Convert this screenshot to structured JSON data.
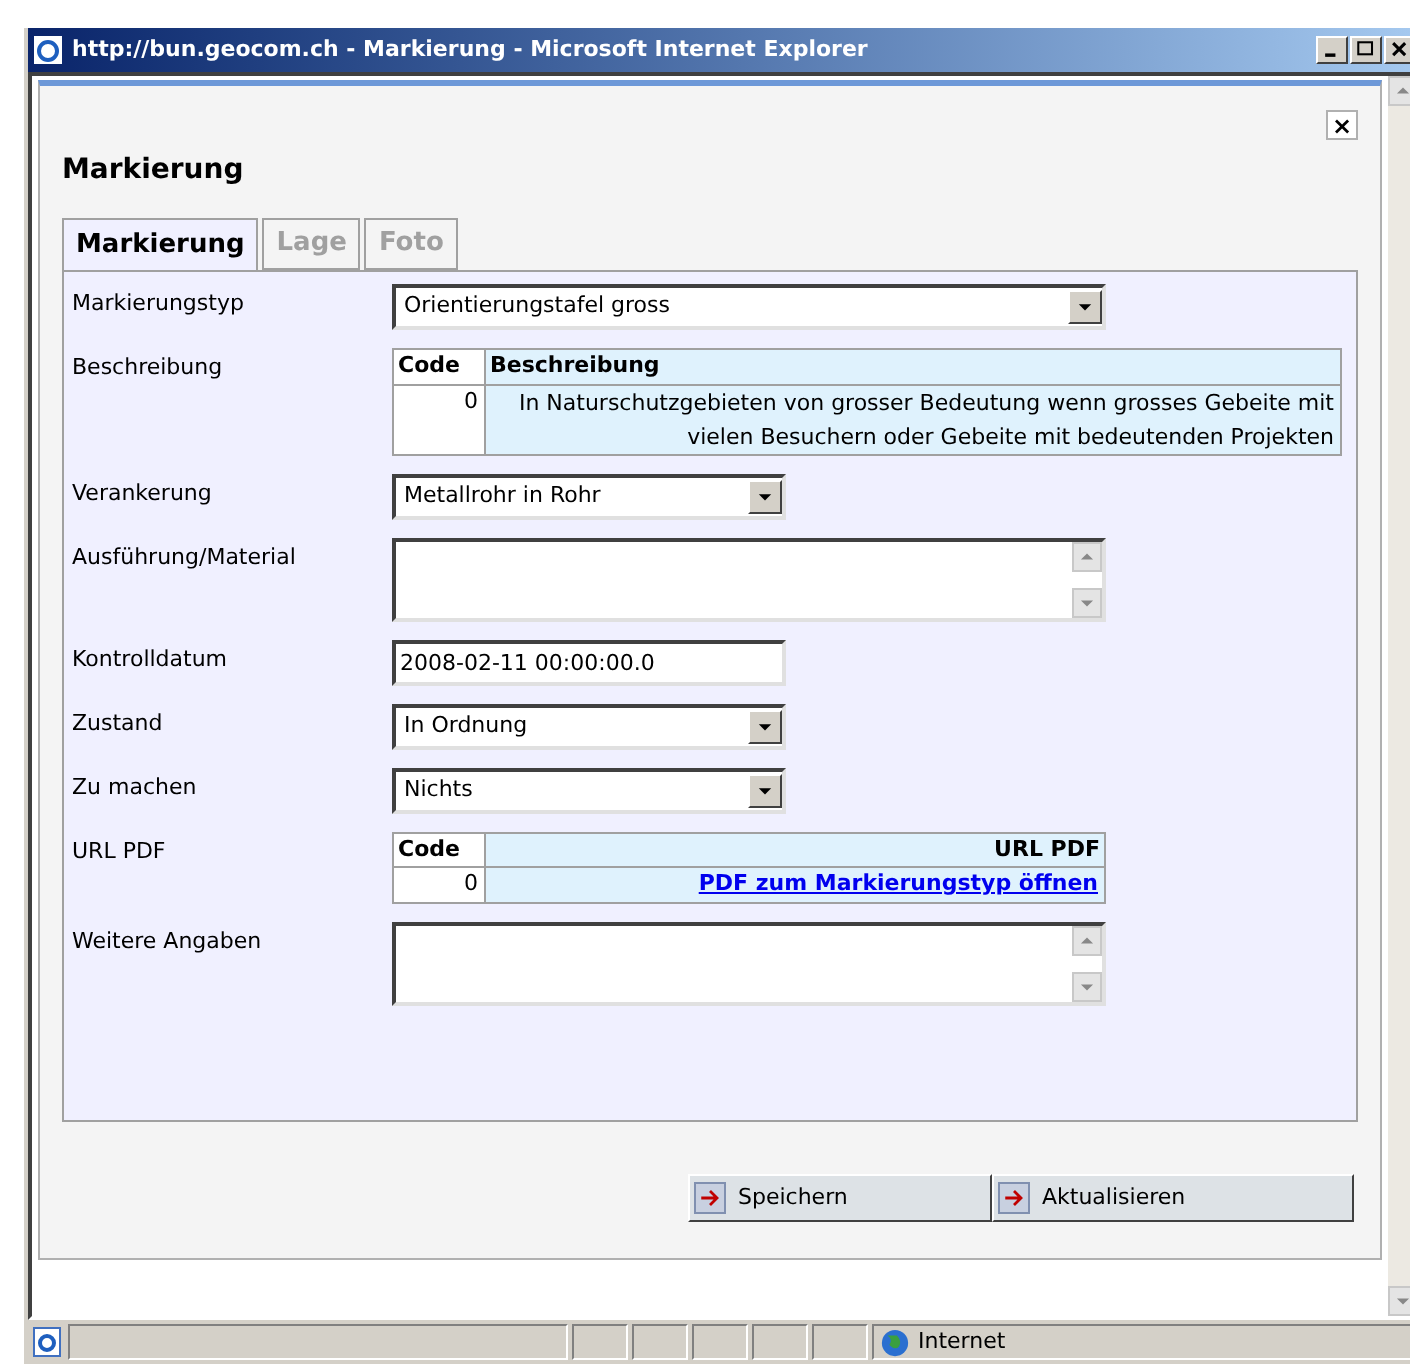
{
  "window": {
    "title": "http://bun.geocom.ch - Markierung - Microsoft Internet Explorer"
  },
  "dialog": {
    "close": "×",
    "title": "Markierung"
  },
  "tabs": [
    {
      "label": "Markierung",
      "selected": true
    },
    {
      "label": "Lage",
      "selected": false
    },
    {
      "label": "Foto",
      "selected": false
    }
  ],
  "fields": [
    {
      "kind": "select",
      "label": "Markierungstyp",
      "value": "Orientierungstafel gross"
    },
    {
      "kind": "table",
      "label": "Beschreibung",
      "columns": [
        "Code",
        "Beschreibung"
      ],
      "rows": [
        {
          "code": "0",
          "text": "In Naturschutzgebieten von grosser Bedeutung wenn grosses Gebeite mit vielen Besuchern oder Gebeite mit bedeutenden Projekten",
          "link": false
        }
      ]
    },
    {
      "kind": "select",
      "label": "Verankerung",
      "value": "Metallrohr in Rohr"
    },
    {
      "kind": "textarea",
      "label": "Ausführung/Material"
    },
    {
      "kind": "text",
      "label": "Kontrolldatum",
      "value": "2008-02-11 00:00:00.0"
    },
    {
      "kind": "select",
      "label": "Zustand",
      "value": "In Ordnung"
    },
    {
      "kind": "select",
      "label": "Zu machen",
      "value": "Nichts"
    },
    {
      "kind": "table",
      "label": "URL PDF",
      "columns": [
        "Code",
        "URL PDF"
      ],
      "rows": [
        {
          "code": "0",
          "text": "PDF zum Markierungstyp öffnen",
          "link": true
        }
      ]
    },
    {
      "kind": "textarea",
      "label": "Weitere Angaben"
    }
  ],
  "buttons": [
    "Speichern",
    "Aktualisieren"
  ],
  "status_bar": {
    "zone": "Internet"
  }
}
